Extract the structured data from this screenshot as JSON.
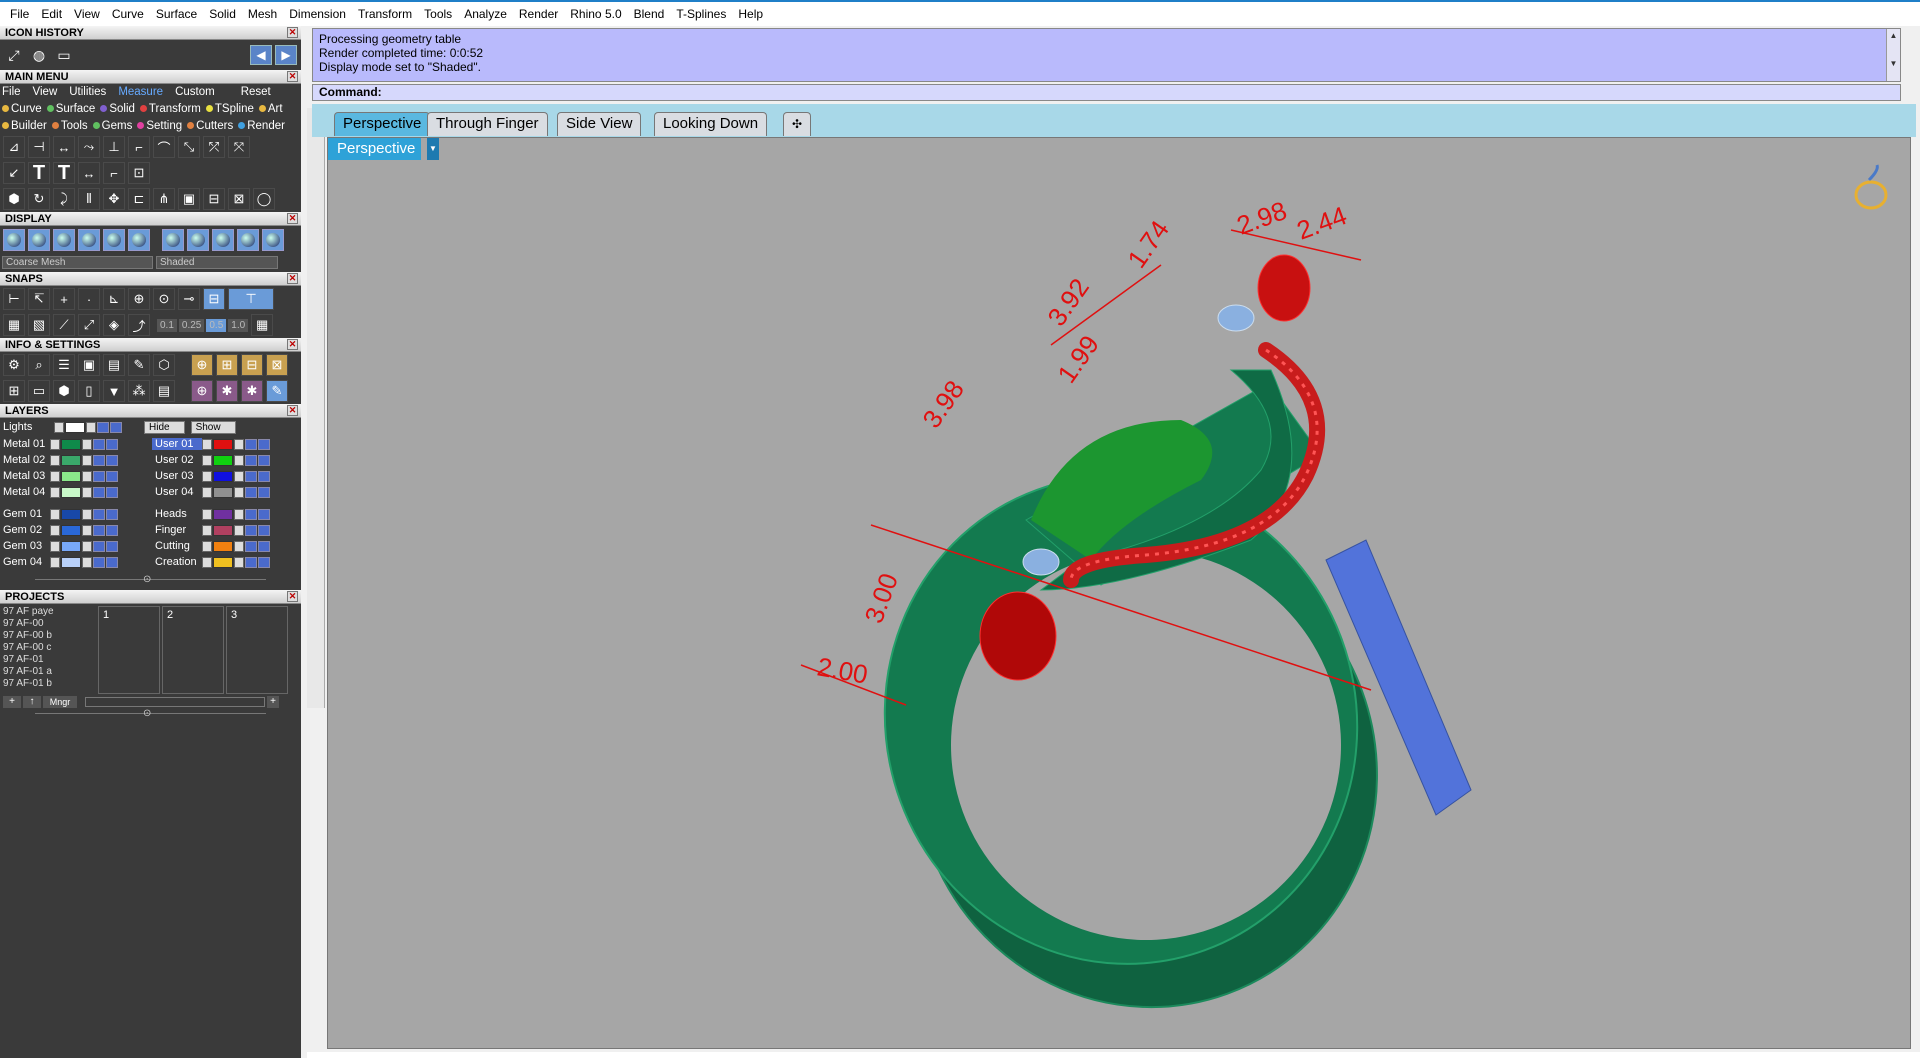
{
  "menubar": [
    "File",
    "Edit",
    "View",
    "Curve",
    "Surface",
    "Solid",
    "Mesh",
    "Dimension",
    "Transform",
    "Tools",
    "Analyze",
    "Render",
    "Rhino 5.0",
    "Blend",
    "T-Splines",
    "Help"
  ],
  "panels": {
    "icon_history": "ICON HISTORY",
    "main_menu": "MAIN MENU",
    "display": "DISPLAY",
    "snaps": "SNAPS",
    "info": "INFO & SETTINGS",
    "layers": "LAYERS",
    "projects": "PROJECTS"
  },
  "main_menu_tabs": [
    "File",
    "View",
    "Utilities",
    "Measure",
    "Custom",
    "Reset"
  ],
  "categories_row1": [
    {
      "label": "Curve",
      "color": "#e8b840"
    },
    {
      "label": "Surface",
      "color": "#60c060"
    },
    {
      "label": "Solid",
      "color": "#8060d0"
    },
    {
      "label": "Transform",
      "color": "#e04040"
    },
    {
      "label": "TSpline",
      "color": "#e8e040"
    },
    {
      "label": "Art",
      "color": "#e8b840"
    }
  ],
  "categories_row2": [
    {
      "label": "Builder",
      "color": "#e8b840"
    },
    {
      "label": "Tools",
      "color": "#e08040"
    },
    {
      "label": "Gems",
      "color": "#60c060"
    },
    {
      "label": "Setting",
      "color": "#e040a0"
    },
    {
      "label": "Cutters",
      "color": "#e08040"
    },
    {
      "label": "Render",
      "color": "#40a0e0"
    }
  ],
  "display": {
    "mesh": "Coarse Mesh",
    "mode": "Shaded"
  },
  "snaps_values": [
    "0.1",
    "0.25",
    "0.5",
    "1.0"
  ],
  "layers": {
    "lights": "Lights",
    "hide": "Hide",
    "show": "Show",
    "left": [
      {
        "n": "Metal 01",
        "c": "#0f8a4a"
      },
      {
        "n": "Metal 02",
        "c": "#3aa86a"
      },
      {
        "n": "Metal 03",
        "c": "#8ae88a"
      },
      {
        "n": "Metal 04",
        "c": "#c8f8c8"
      },
      {
        "n": "Gem 01",
        "c": "#1848a8"
      },
      {
        "n": "Gem 02",
        "c": "#2a68d8"
      },
      {
        "n": "Gem 03",
        "c": "#78a8f8"
      },
      {
        "n": "Gem 04",
        "c": "#b8d0f8"
      }
    ],
    "right": [
      {
        "n": "User 01",
        "c": "#e01010"
      },
      {
        "n": "User 02",
        "c": "#10d010"
      },
      {
        "n": "User 03",
        "c": "#1010e0"
      },
      {
        "n": "User 04",
        "c": "#909090"
      },
      {
        "n": "Heads",
        "c": "#7030a0"
      },
      {
        "n": "Finger",
        "c": "#b04060"
      },
      {
        "n": "Cutting",
        "c": "#f08010"
      },
      {
        "n": "Creation",
        "c": "#f0c020"
      }
    ]
  },
  "projects": {
    "list": [
      "97 AF paye",
      "97 AF-00",
      "97 AF-00 b",
      "97 AF-00 c",
      "97 AF-01",
      "97 AF-01 a",
      "97 AF-01 b"
    ],
    "slots": [
      "1",
      "2",
      "3"
    ],
    "mngr": "Mngr"
  },
  "history": [
    "Processing geometry table",
    "Render completed time: 0:0:52",
    "Display mode set to \"Shaded\"."
  ],
  "command": "Command:",
  "tabs": [
    "Perspective",
    "Through Finger",
    "Side View",
    "Looking Down"
  ],
  "viewport_label": "Perspective",
  "dimensions": [
    "3.92",
    "1.74",
    "2.98",
    "2.44",
    "1.99",
    "3.98",
    "3.00",
    "2.00"
  ]
}
